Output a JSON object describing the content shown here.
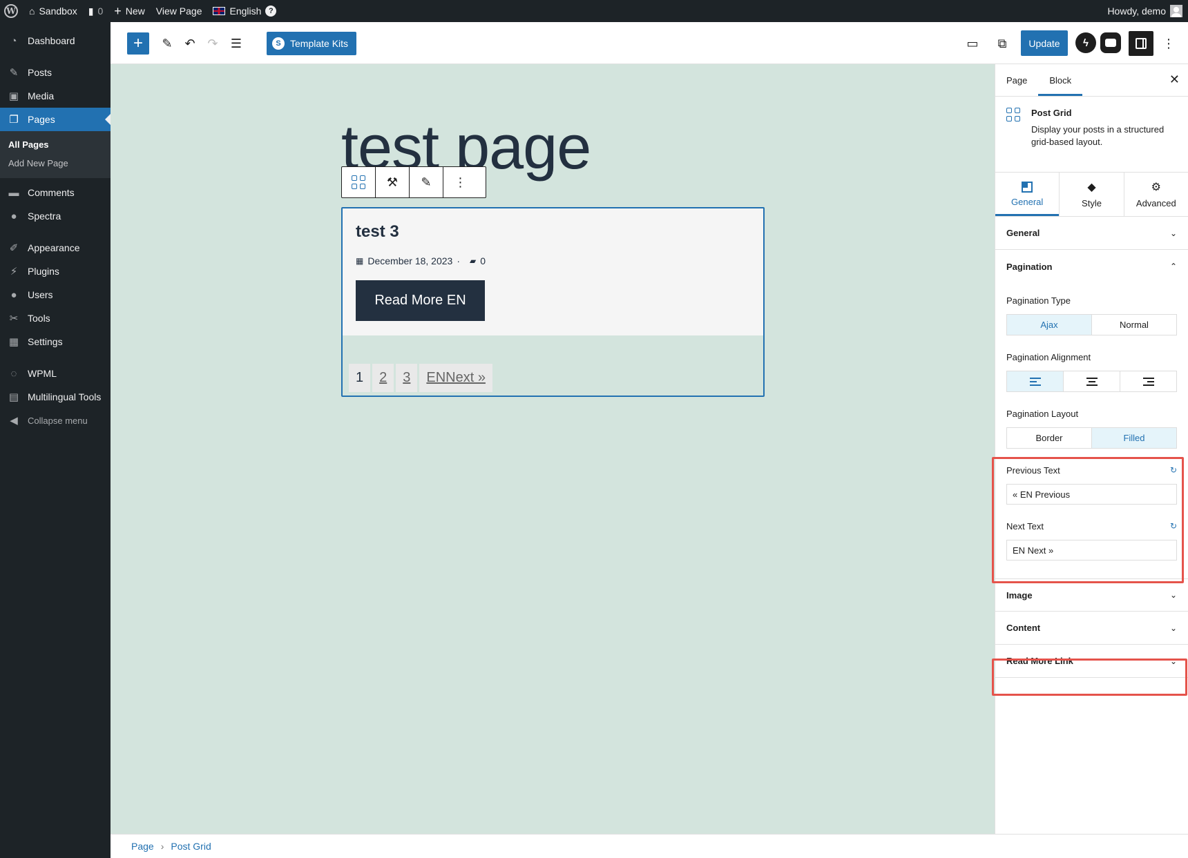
{
  "adminbar": {
    "site_name": "Sandbox",
    "comments_count": "0",
    "new_label": "New",
    "view_page_label": "View Page",
    "language_label": "English",
    "help_label": "?",
    "howdy_label": "Howdy, demo"
  },
  "sidebar": {
    "dashboard": "Dashboard",
    "posts": "Posts",
    "media": "Media",
    "pages": "Pages",
    "all_pages": "All Pages",
    "add_new_page": "Add New Page",
    "comments": "Comments",
    "spectra": "Spectra",
    "appearance": "Appearance",
    "plugins": "Plugins",
    "users": "Users",
    "tools": "Tools",
    "settings": "Settings",
    "wpml": "WPML",
    "multilingual_tools": "Multilingual Tools",
    "collapse_menu": "Collapse menu"
  },
  "header": {
    "add_label": "+",
    "template_kits_label": "Template Kits",
    "update_label": "Update"
  },
  "canvas": {
    "page_title": "test page",
    "post": {
      "title": "test 3",
      "date": "December 18, 2023",
      "separator": "·",
      "comments": "0",
      "read_more": "Read More EN"
    },
    "pagination": [
      "1",
      "2",
      "3",
      "ENNext »"
    ]
  },
  "breadcrumbs": {
    "page": "Page",
    "separator": "›",
    "current": "Post Grid"
  },
  "settings_panel": {
    "tab_page": "Page",
    "tab_block": "Block",
    "block_name": "Post Grid",
    "block_desc": "Display your posts in a structured grid-based layout.",
    "inner_tabs": {
      "general": "General",
      "style": "Style",
      "advanced": "Advanced"
    },
    "sections": {
      "general": "General",
      "pagination": "Pagination",
      "image": "Image",
      "content": "Content",
      "read_more_link": "Read More Link"
    },
    "pagination_type_label": "Pagination Type",
    "pagination_type_options": [
      "Ajax",
      "Normal"
    ],
    "pagination_type_selected": "Ajax",
    "pagination_alignment_label": "Pagination Alignment",
    "pagination_alignment_selected": "left",
    "pagination_layout_label": "Pagination Layout",
    "pagination_layout_options": [
      "Border",
      "Filled"
    ],
    "pagination_layout_selected": "Filled",
    "previous_text_label": "Previous Text",
    "previous_text_value": "« EN Previous",
    "next_text_label": "Next Text",
    "next_text_value": "EN Next »"
  },
  "colors": {
    "wp_blue": "#2271b1",
    "admin_dark": "#1d2327",
    "canvas_bg": "#d3e4dd",
    "button_dark": "#233040",
    "highlight": "#e5534b"
  }
}
